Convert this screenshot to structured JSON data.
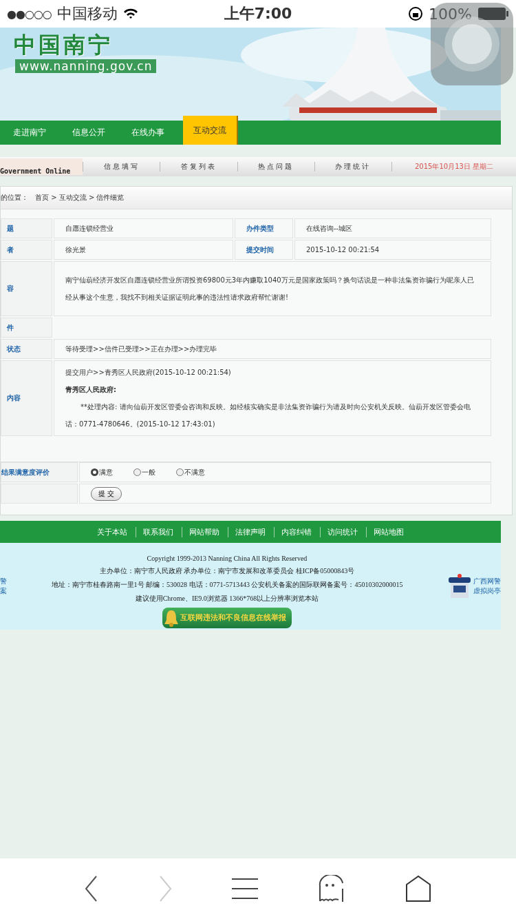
{
  "status_bar": {
    "signal": "●●○○○",
    "carrier": "中国移动",
    "time": "上午7:00",
    "battery": "100%"
  },
  "header": {
    "logo": "中国南宁",
    "url": "www.nanning.gov.cn"
  },
  "nav": [
    {
      "label": "走进南宁",
      "selected": false
    },
    {
      "label": "信息公开",
      "selected": false
    },
    {
      "label": "在线办事",
      "selected": false
    },
    {
      "label": "互动交流",
      "selected": true
    }
  ],
  "subnav": {
    "badge": "Government Online",
    "items": [
      "信息填写",
      "答复列表",
      "热点问题",
      "办理统计"
    ],
    "date": "2015年10月13日 星期二"
  },
  "breadcrumb": {
    "label": "的位置：",
    "path": "首页 > 互动交流 > 信件细览"
  },
  "letter": {
    "subject_label": "题",
    "subject": "自愿连锁经营业",
    "type_label": "办件类型",
    "type": "在线咨询--城区",
    "author_label": "者",
    "author": "徐光景",
    "time_label": "提交时间",
    "time": "2015-10-12 00:21:54",
    "content_label": "容",
    "content": "南宁仙葫经济开发区自愿连锁经营业所谓投资69800元3年内赚取1040万元是国家政策吗？换句话说是一种非法集资诈骗行为呢亲人已经从事这个生意，我找不到相关证据证明此事的违法性请求政府帮忙谢谢!",
    "attachment_label": "件",
    "status_label": "状态",
    "status": "等待受理>>信件已受理>>正在办理>>办理完毕",
    "reply_label": "内容",
    "reply_route": "提交用户>>青秀区人民政府(2015-10-12 00:21:54)",
    "reply_from": "青秀区人民政府:",
    "reply_text": "**处理内容:  请向仙葫开发区管委会咨询和反映。如经核实确实是非法集资诈骗行为请及时向公安机关反映。仙葫开发区管委会电话：0771-4780646。(2015-10-12 17:43:01)"
  },
  "rating": {
    "label": "结果满意度评价",
    "options": [
      {
        "label": "满意",
        "selected": true
      },
      {
        "label": "一般",
        "selected": false
      },
      {
        "label": "不满意",
        "selected": false
      }
    ],
    "submit": "提 交"
  },
  "footer": {
    "links": [
      "关于本站",
      "联系我们",
      "网站帮助",
      "法律声明",
      "内容纠错",
      "访问统计",
      "网站地图"
    ],
    "lines": [
      "Copyright 1999-2013 Nanning China All Rights Reserved",
      "主办单位：南宁市人民政府  承办单位：南宁市发展和改革委员会  桂ICP备05000843号",
      "地址：南宁市桂春路南一里1号 邮编：530028 电话：0771-5713443  公安机关备案的国际联网备案号：45010302000015",
      "建议使用Chrome、IE9.0浏览器 1366*768以上分辨率浏览本站"
    ],
    "left_badge": [
      "警",
      "案"
    ],
    "right_badge": [
      "广西网警",
      "虚拟岗亭"
    ],
    "report": "互联网违法和不良信息在线举报"
  }
}
